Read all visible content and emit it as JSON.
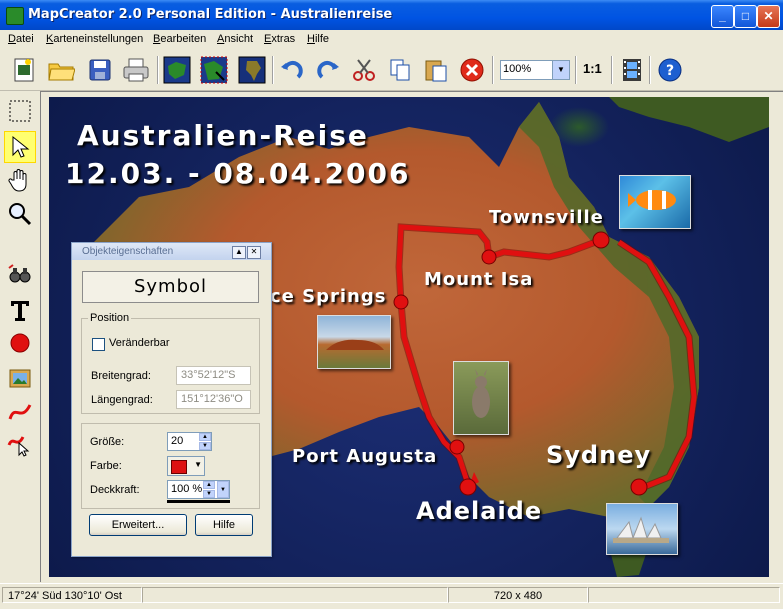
{
  "window": {
    "title": "MapCreator 2.0 Personal Edition - Australienreise",
    "controls": {
      "minimize": "_",
      "maximize": "□",
      "close": "✕"
    }
  },
  "menu": [
    {
      "label": "Datei",
      "accel": "D"
    },
    {
      "label": "Karteneinstellungen",
      "accel": "K"
    },
    {
      "label": "Bearbeiten",
      "accel": "B"
    },
    {
      "label": "Ansicht",
      "accel": "A"
    },
    {
      "label": "Extras",
      "accel": "E"
    },
    {
      "label": "Hilfe",
      "accel": "H"
    }
  ],
  "toolbar": {
    "icons": [
      "new-map-icon",
      "open-folder-icon",
      "save-icon",
      "print-icon",
      "map-region-icon",
      "map-export-icon",
      "africa-map-icon",
      "undo-icon",
      "redo-icon",
      "cut-icon",
      "copy-icon",
      "paste-icon",
      "delete-icon",
      "film-icon",
      "help-icon"
    ],
    "zoom_value": "100%",
    "ratio_label": "1:1"
  },
  "palette": {
    "tools": [
      "selection-rect-icon",
      "pointer-icon",
      "hand-icon",
      "magnifier-icon",
      "binoculars-icon",
      "text-tool-icon",
      "circle-symbol-icon",
      "picture-icon",
      "route-line-icon",
      "route-pointer-icon"
    ],
    "active": "pointer-icon"
  },
  "map": {
    "title_line1": "Australien-Reise",
    "title_line2": "12.03. - 08.04.2006",
    "cities": {
      "townsville": "Townsville",
      "mount_isa": "Mount Isa",
      "alice_springs": "ce Springs",
      "port_augusta": "Port Augusta",
      "adelaide": "Adelaide",
      "sydney": "Sydney"
    },
    "route_color": "#e01010"
  },
  "dialog": {
    "title": "Objekteigenschaften",
    "symbol_label": "Symbol",
    "position_group": "Position",
    "changeable_label": "Veränderbar",
    "changeable_checked": false,
    "latitude_label": "Breitengrad:",
    "latitude_value": "33°52'12\"S",
    "longitude_label": "Längengrad:",
    "longitude_value": "151°12'36\"O",
    "size_label": "Größe:",
    "size_value": "20",
    "color_label": "Farbe:",
    "color_value": "#dd1111",
    "opacity_label": "Deckkraft:",
    "opacity_value": "100 %",
    "extended_button": "Erweitert...",
    "help_button": "Hilfe"
  },
  "status": {
    "coords": "17°24' Süd   130°10' Ost",
    "dimensions": "720 x 480"
  }
}
